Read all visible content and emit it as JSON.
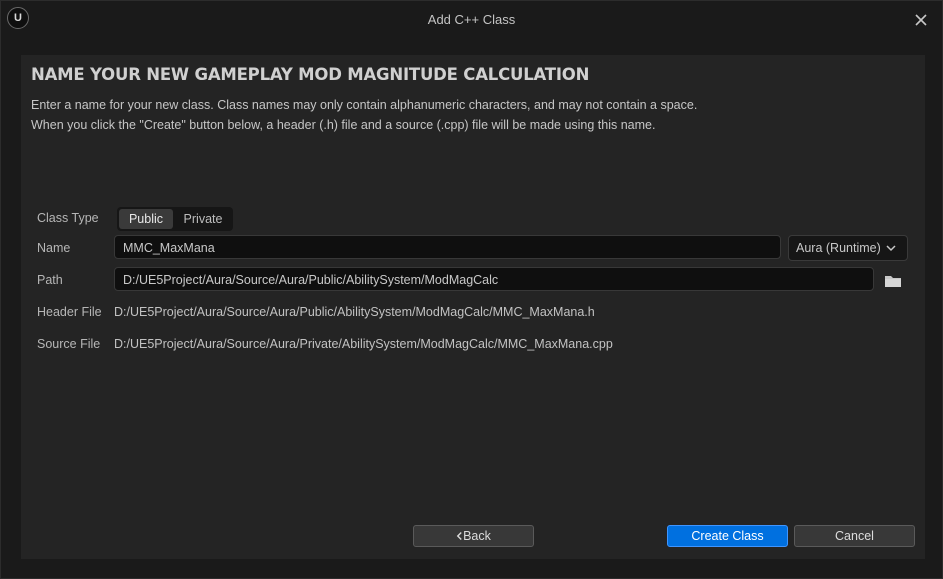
{
  "window": {
    "title": "Add C++ Class",
    "logo_text": "U"
  },
  "heading": "NAME YOUR NEW GAMEPLAY MOD MAGNITUDE CALCULATION",
  "description": [
    "Enter a name for your new class. Class names may only contain alphanumeric characters, and may not contain a space.",
    "When you click the \"Create\" button below, a header (.h) file and a source (.cpp) file will be made using this name."
  ],
  "form": {
    "class_type_label": "Class Type",
    "class_type_options": [
      "Public",
      "Private"
    ],
    "class_type_selected": "Public",
    "name_label": "Name",
    "name_value": "MMC_MaxMana",
    "module_selected": "Aura (Runtime)",
    "path_label": "Path",
    "path_value": "D:/UE5Project/Aura/Source/Aura/Public/AbilitySystem/ModMagCalc",
    "header_file_label": "Header File",
    "header_file_value": "D:/UE5Project/Aura/Source/Aura/Public/AbilitySystem/ModMagCalc/MMC_MaxMana.h",
    "source_file_label": "Source File",
    "source_file_value": "D:/UE5Project/Aura/Source/Aura/Private/AbilitySystem/ModMagCalc/MMC_MaxMana.cpp"
  },
  "buttons": {
    "back": "Back",
    "create": "Create Class",
    "cancel": "Cancel"
  },
  "icons": {
    "logo": "unreal-logo-icon",
    "close": "close-icon",
    "dropdown": "chevron-down-icon",
    "folder": "folder-icon",
    "back": "chevron-left-icon"
  },
  "colors": {
    "primary_button": "#0070e0",
    "panel": "#242424",
    "window": "#1a1a1a"
  }
}
